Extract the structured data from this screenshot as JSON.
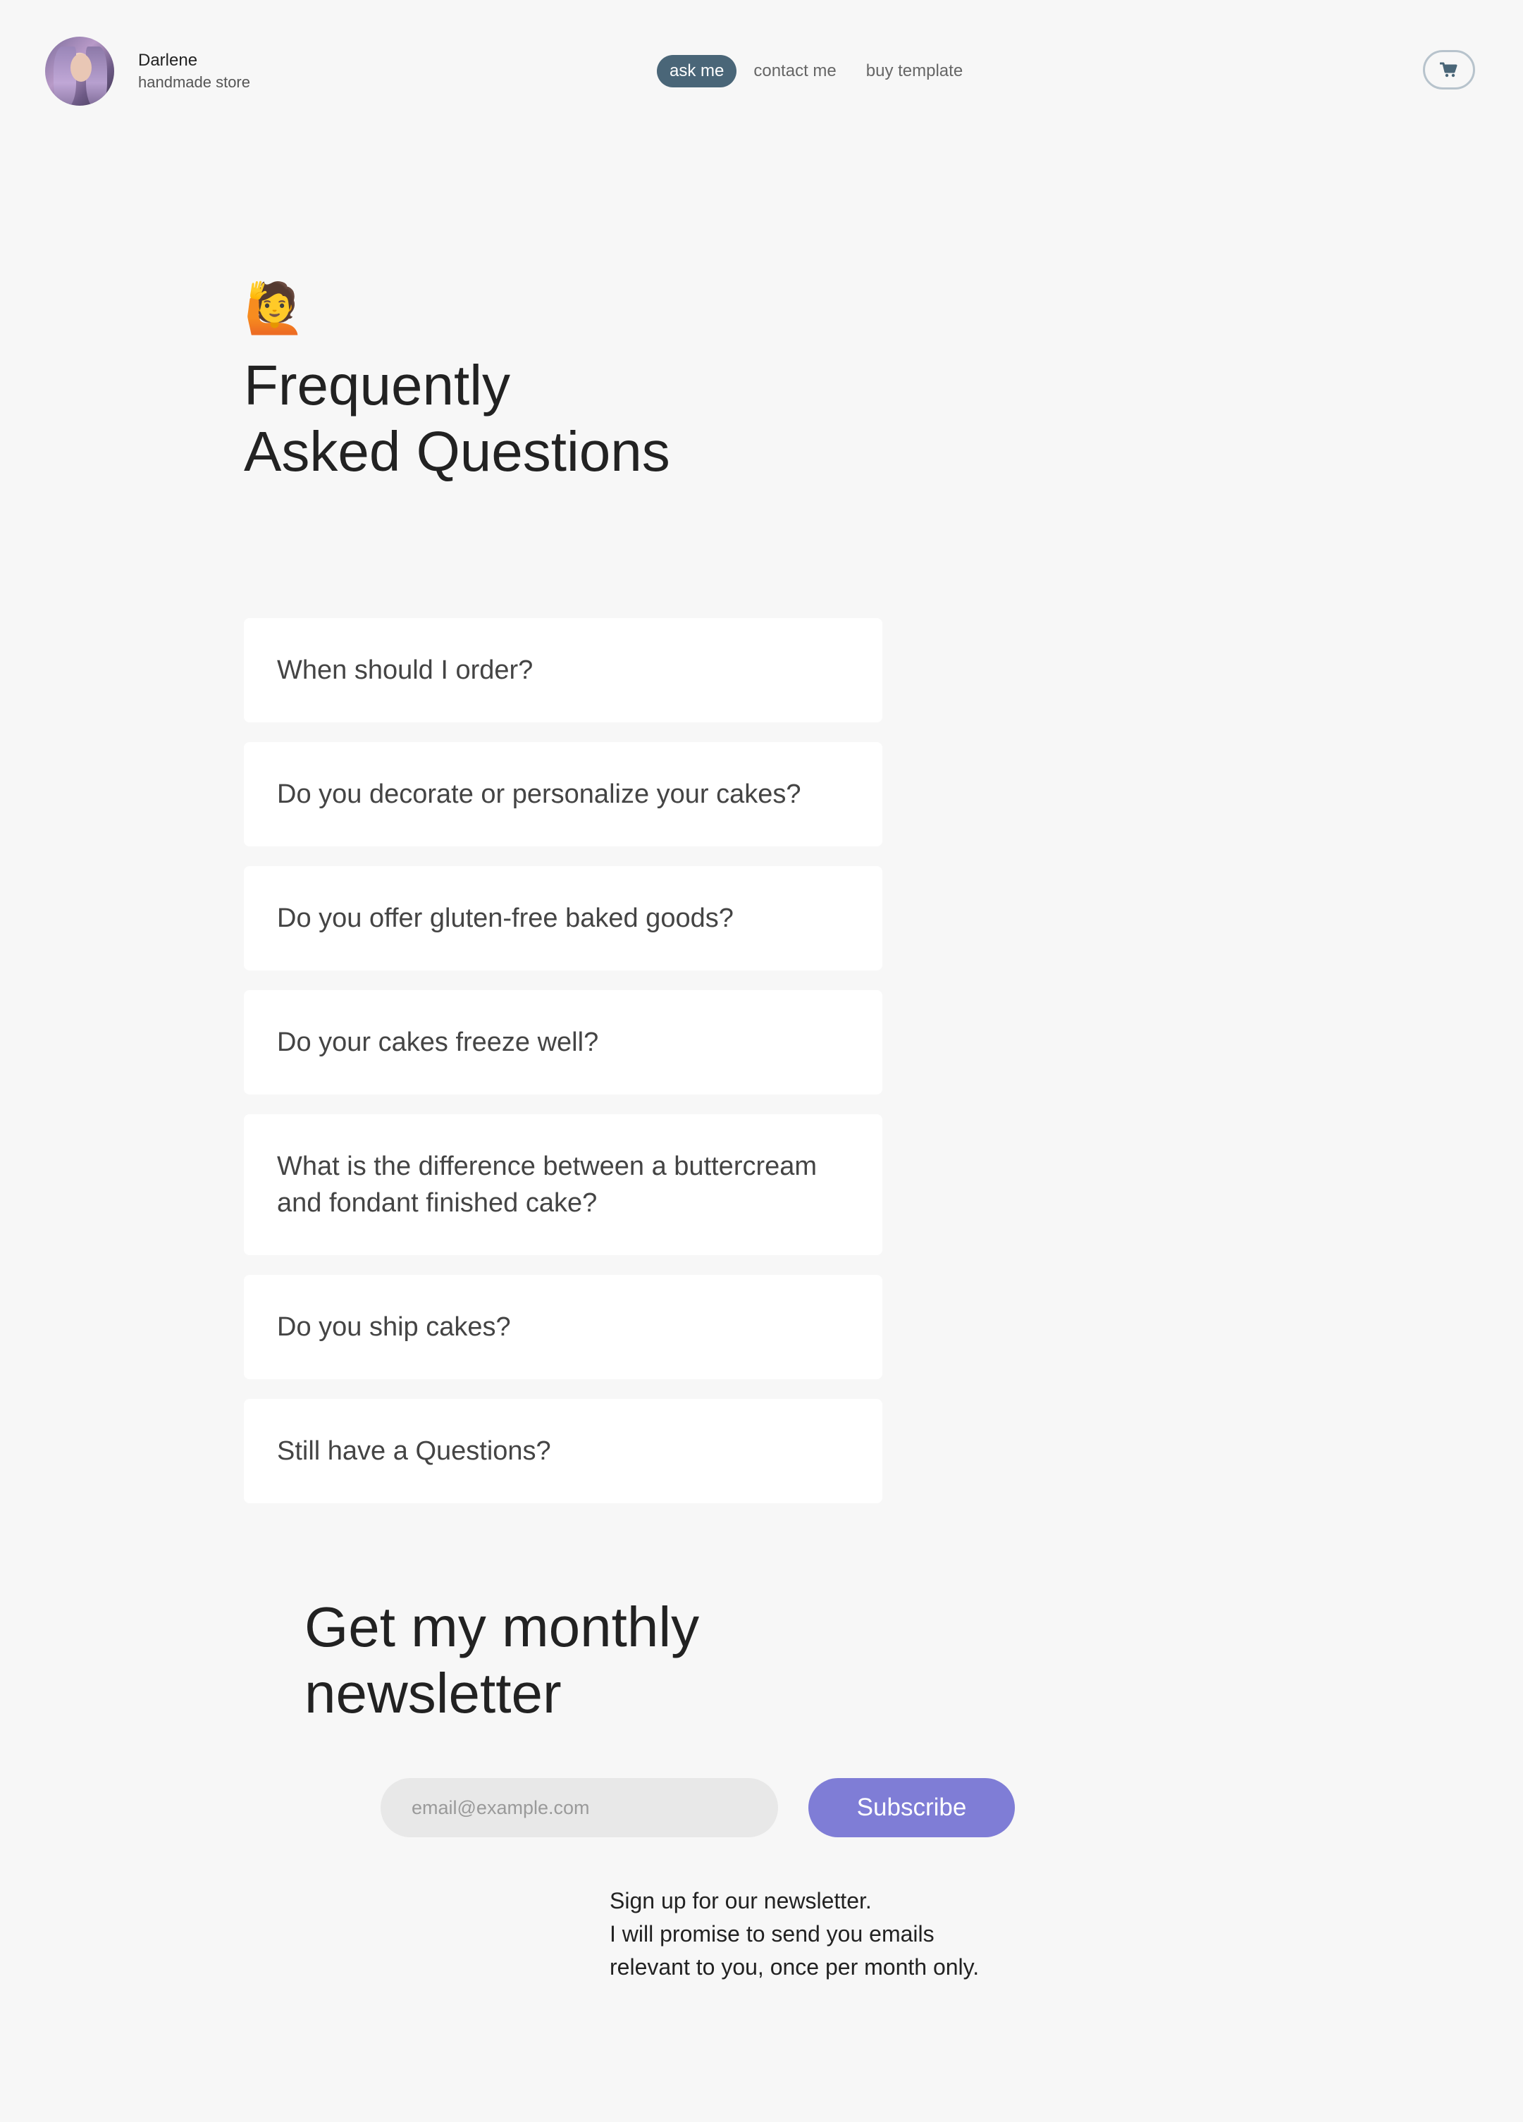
{
  "brand": {
    "name": "Darlene",
    "subtitle": "handmade store"
  },
  "nav": {
    "items": [
      {
        "label": "ask me",
        "active": true
      },
      {
        "label": "contact me",
        "active": false
      },
      {
        "label": "buy template",
        "active": false
      }
    ]
  },
  "cart": {
    "icon": "cart-icon"
  },
  "faq": {
    "emoji": "🙋",
    "title_line1": "Frequently",
    "title_line2": "Asked Questions",
    "questions": [
      "When should I order?",
      "Do you decorate or personalize your cakes?",
      "Do you offer gluten-free baked goods?",
      "Do your cakes freeze well?",
      "What is the difference between a buttercream and fondant finished cake?",
      "Do you ship cakes?",
      "Still have a Questions?"
    ]
  },
  "newsletter": {
    "title_line1": "Get my monthly",
    "title_line2": "newsletter",
    "email_placeholder": "email@example.com",
    "subscribe_label": "Subscribe",
    "desc_line1": "Sign up for our newsletter.",
    "desc_line2": "I will promise to send you emails",
    "desc_line3": "relevant to you, once per month only."
  },
  "colors": {
    "background": "#f7f7f7",
    "nav_active": "#4a6678",
    "subscribe": "#7f7dd6",
    "input_bg": "#e8e8e8"
  }
}
